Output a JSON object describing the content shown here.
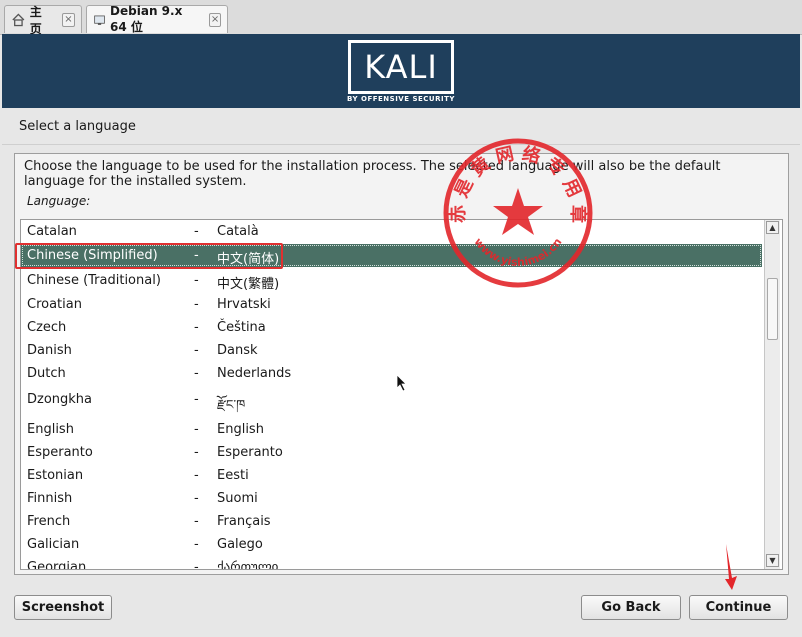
{
  "tabs": [
    {
      "label": "主页",
      "icon": "home-icon",
      "active": false
    },
    {
      "label": "Debian 9.x 64 位",
      "icon": "vm-icon",
      "active": true
    }
  ],
  "banner": {
    "logo_text": "KALI",
    "logo_sub": "BY OFFENSIVE SECURITY"
  },
  "page": {
    "title": "Select a language",
    "description": "Choose the language to be used for the installation process. The selected language will also be the default language for the installed system.",
    "language_label": "Language:"
  },
  "languages": [
    {
      "name": "Catalan",
      "native": "Català"
    },
    {
      "name": "Chinese (Simplified)",
      "native": "中文(简体)",
      "selected": true
    },
    {
      "name": "Chinese (Traditional)",
      "native": "中文(繁體)"
    },
    {
      "name": "Croatian",
      "native": "Hrvatski"
    },
    {
      "name": "Czech",
      "native": "Čeština"
    },
    {
      "name": "Danish",
      "native": "Dansk"
    },
    {
      "name": "Dutch",
      "native": "Nederlands"
    },
    {
      "name": "Dzongkha",
      "native": "རྫོང་ཁ"
    },
    {
      "name": "English",
      "native": "English"
    },
    {
      "name": "Esperanto",
      "native": "Esperanto"
    },
    {
      "name": "Estonian",
      "native": "Eesti"
    },
    {
      "name": "Finnish",
      "native": "Suomi"
    },
    {
      "name": "French",
      "native": "Français"
    },
    {
      "name": "Galician",
      "native": "Galego"
    },
    {
      "name": "Georgian",
      "native": "ქართული"
    }
  ],
  "separator": "-",
  "buttons": {
    "screenshot": "Screenshot",
    "go_back": "Go Back",
    "continue": "Continue"
  },
  "stamp": {
    "text": "赤 是 黄 网 络 专 用 章",
    "url": "www.yishimei.cn"
  },
  "colors": {
    "banner": "#1f3f5c",
    "selection": "#4a7065",
    "highlight_box": "#e03030",
    "stamp": "#e3262b"
  }
}
